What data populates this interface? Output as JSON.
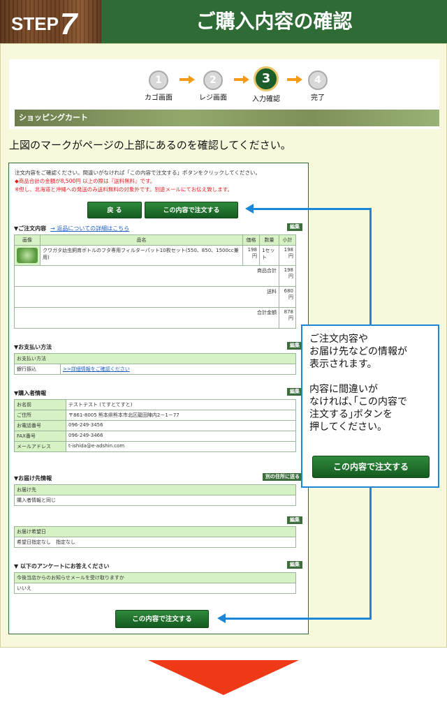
{
  "header": {
    "step_label": "STEP",
    "step_number": "7",
    "title": "ご購入内容の確認"
  },
  "progress": {
    "steps": [
      {
        "number": "1",
        "label": "カゴ画面"
      },
      {
        "number": "2",
        "label": "レジ画面"
      },
      {
        "number": "3",
        "label": "入力確認"
      },
      {
        "number": "4",
        "label": "完了"
      }
    ],
    "active_step": 3,
    "bar_label": "ショッピングカート"
  },
  "instruction": "上図のマークがページの上部にあるのを確認してください。",
  "screenshot": {
    "notice_1": "注文内容をご確認ください。間違いがなければ「この内容で注文する」ボタンをクリックしてください。",
    "notice_2": "◆商品合計の金額が8,500円 以上の際は『送料無料』です。",
    "notice_3": "※但し、北海道と沖縄への発送のみ送料無料の対象外です。別途メールにてお伝え致します。",
    "back_button": "戻 る",
    "confirm_button": "この内容で注文する",
    "order": {
      "heading": "▼ご注文内容",
      "return_link": "→ 返品についての詳細はこちら",
      "edit": "編集",
      "columns": [
        "画像",
        "品名",
        "価格",
        "数量",
        "小計"
      ],
      "item_name": "クワガタ幼虫飼育ボトルのフタ専用フィルターパット10枚セット(550、850、1500cc兼用)",
      "item_price": "198円",
      "item_qty": "1セット",
      "item_subtotal": "198円",
      "subtotal_label": "商品合計",
      "subtotal_value": "198円",
      "shipping_label": "送料",
      "shipping_value": "680円",
      "total_label": "合計金額",
      "total_value": "878円"
    },
    "payment": {
      "heading": "▼お支払い方法",
      "edit": "編集",
      "header": "お支払い方法",
      "method": "銀行振込",
      "detail_link": ">>詳細情報をご確認ください"
    },
    "buyer": {
      "heading": "▼購入者情報",
      "edit": "編集",
      "rows": [
        {
          "label": "お名前",
          "value": "テストテスト (てすとてすと)"
        },
        {
          "label": "ご住所",
          "value": "〒861-8005 熊本県熊本市北区龍田陣内2－1－77"
        },
        {
          "label": "お電話番号",
          "value": "096-249-3456"
        },
        {
          "label": "FAX番号",
          "value": "096-249-3466"
        },
        {
          "label": "メールアドレス",
          "value": "t-ishida@e-adshin.com"
        }
      ]
    },
    "delivery": {
      "heading": "▼お届け先情報",
      "other_address_button": "別の住所に送る",
      "header": "お届け先",
      "value": "購入者情報と同じ"
    },
    "delivery_date": {
      "edit": "編集",
      "header": "お届け希望日",
      "value": "希望日指定なし　指定なし"
    },
    "survey": {
      "heading": "▼ 以下のアンケートにお答えください",
      "edit": "編集",
      "question": "今後当店からのお知らせメールを受け取りますか",
      "answer": "いいえ"
    },
    "bottom_confirm_button": "この内容で注文する"
  },
  "callout": {
    "text": "ご注文内容や\nお届け先などの情報が\n表示されます。\n\n内容に間違いが\nなければ､｢この内容で\n注文する｣ボタンを\n押してください。",
    "button": "この内容で注文する"
  },
  "colors": {
    "header_green": "#2f6b35",
    "panel_bg": "#f8f8dc",
    "callout_blue": "#1a86d9",
    "down_arrow": "#ef3a17"
  }
}
